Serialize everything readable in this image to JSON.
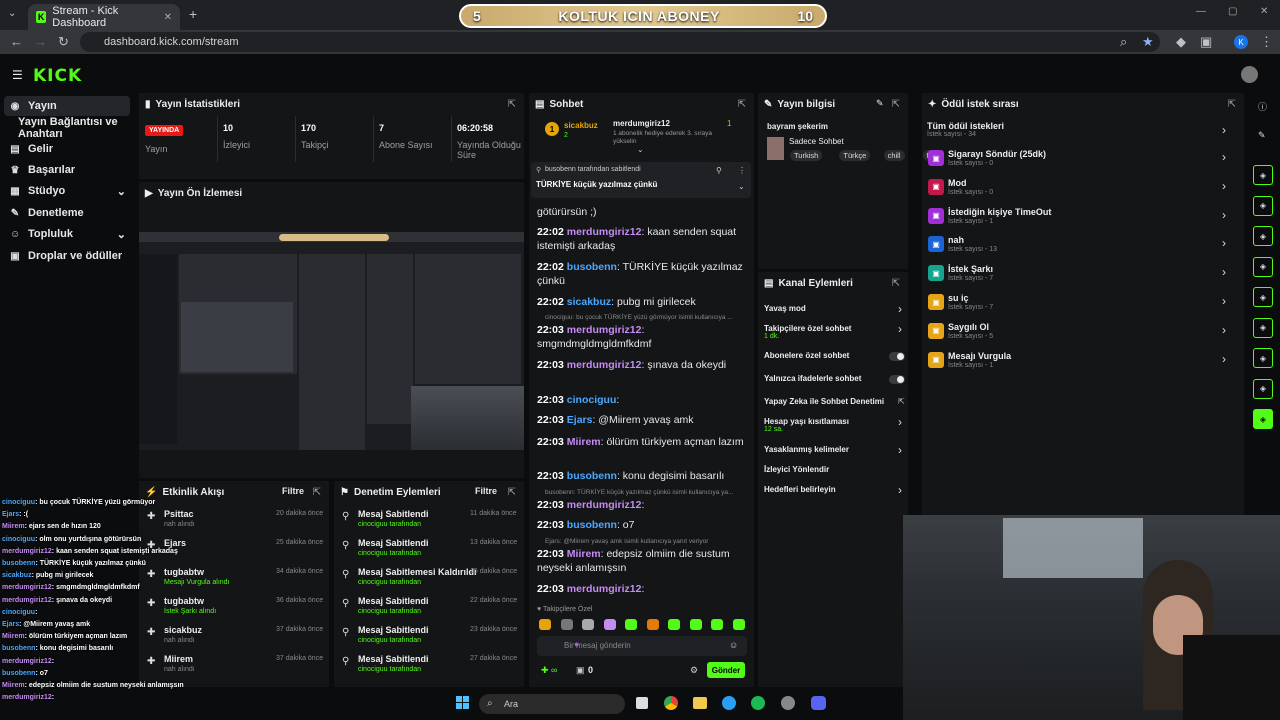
{
  "browser": {
    "tab_title": "Stream - Kick Dashboard",
    "url": "dashboard.kick.com/stream"
  },
  "overlay_banner": {
    "left": "5",
    "title": "KOLTUK ICIN ABONEY",
    "right": "10"
  },
  "logo": "KICK",
  "sidebar": {
    "items": [
      {
        "label": "Yayın",
        "icon": "broadcast-icon"
      },
      {
        "label": "Yayın Bağlantısı ve Anahtarı",
        "icon": ""
      },
      {
        "label": "Gelir",
        "icon": "money-icon"
      },
      {
        "label": "Başarılar",
        "icon": "trophy-icon"
      },
      {
        "label": "Stüdyo",
        "icon": "studio-icon"
      },
      {
        "label": "Denetleme",
        "icon": "wrench-icon"
      },
      {
        "label": "Topluluk",
        "icon": "users-icon"
      },
      {
        "label": "Droplar ve ödüller",
        "icon": "gift-icon"
      }
    ]
  },
  "stats": {
    "title": "Yayın İstatistikleri",
    "live": "YAYINDA",
    "live_label": "Yayın",
    "viewers": "10",
    "viewers_label": "İzleyici",
    "followers": "170",
    "followers_label": "Takipçi",
    "subs": "7",
    "subs_label": "Abone Sayısı",
    "uptime": "06:20:58",
    "uptime_label": "Yayında Olduğu Süre"
  },
  "preview": {
    "title": "Yayın Ön İzlemesi"
  },
  "activity": {
    "title": "Etkinlik Akışı",
    "filter": "Filtre",
    "rows": [
      {
        "name": "Psittac",
        "sub": "nah alındı",
        "time": "20 dakika önce"
      },
      {
        "name": "Ejars",
        "sub": "",
        "time": "25 dakika önce"
      },
      {
        "name": "tugbabtw",
        "sub": "Mesajı Vurgula alındı",
        "time": "34 dakika önce"
      },
      {
        "name": "tugbabtw",
        "sub": "İstek Şarkı alındı",
        "time": "36 dakika önce"
      },
      {
        "name": "sicakbuz",
        "sub": "nah alındı",
        "time": "37 dakika önce"
      },
      {
        "name": "Miirem",
        "sub": "nah alındı",
        "time": "37 dakika önce"
      }
    ]
  },
  "moderation": {
    "title": "Denetim Eylemleri",
    "filter": "Filtre",
    "rows": [
      {
        "name": "Mesaj Sabitlendi",
        "sub": "cinociguu tarafından",
        "time": "11 dakika önce"
      },
      {
        "name": "Mesaj Sabitlendi",
        "sub": "cinociguu tarafından",
        "time": "13 dakika önce"
      },
      {
        "name": "Mesaj Sabitlemesi Kaldırıldı",
        "sub": "cinociguu tarafından",
        "time": "15 dakika önce"
      },
      {
        "name": "Mesaj Sabitlendi",
        "sub": "cinociguu tarafından",
        "time": "22 dakika önce"
      },
      {
        "name": "Mesaj Sabitlendi",
        "sub": "cinociguu tarafından",
        "time": "23 dakika önce"
      },
      {
        "name": "Mesaj Sabitlendi",
        "sub": "cinociguu tarafından",
        "time": "27 dakika önce"
      }
    ]
  },
  "chat": {
    "title": "Sohbet",
    "gift_user": "sicakbuz",
    "gift_count": "2",
    "gift_target": "merdumgiriz12",
    "gift_target_count": "1",
    "gift_text": "1 abonelik hediye ederek 3. sıraya yükselin",
    "pinned_by": "busobenn tarafından sabitlendi",
    "pinned_text": "TÜRKİYE küçük yazılmaz çünkü",
    "messages": [
      {
        "time": "",
        "user": "",
        "text": "götürürsün ;)"
      },
      {
        "time": "22:02",
        "user": "merdumgiriz12",
        "text": ": kaan senden squat istemişti arkadaş"
      },
      {
        "time": "22:02",
        "user": "busobenn",
        "text": ": TÜRKİYE küçük yazılmaz çünkü"
      },
      {
        "time": "22:02",
        "user": "sicakbuz",
        "text": ": pubg mi girilecek"
      },
      {
        "time": "22:03",
        "user": "merdumgiriz12",
        "text": ": smgmdmgldmgldmfkdmf"
      },
      {
        "time": "22:03",
        "user": "merdumgiriz12",
        "text": ": şınava da okeydi"
      },
      {
        "time": "22:03",
        "user": "cinociguu",
        "text": ":"
      },
      {
        "time": "22:03",
        "user": "Ejars",
        "text": ": @Miirem yavaş amk"
      },
      {
        "time": "22:03",
        "user": "Miirem",
        "text": ": ölürüm türkiyem açman lazım"
      },
      {
        "time": "22:03",
        "user": "busobenn",
        "text": ": konu degisimi basarılı"
      },
      {
        "time": "22:03",
        "user": "merdumgiriz12",
        "text": ":"
      },
      {
        "time": "22:03",
        "user": "busobenn",
        "text": ": o7"
      },
      {
        "time": "22:03",
        "user": "Miirem",
        "text": ": edepsiz olmiim die sustum neyseki anlamışsın"
      },
      {
        "time": "22:03",
        "user": "merdumgiriz12",
        "text": ":"
      }
    ],
    "sys1": "cinociguu: bu çocuk TÜRKİYE yüzü görmüyor isimli kullanıcıya ...",
    "sys2": "busobenn: TÜRKİYE küçük yazılmaz çünkü isimli kullanıcıya ya...",
    "sys3": "Ejars: @Miirem yavaş amk isimli kullanıcıya yanıt veriyor",
    "followers_only": "Takipçilere Özel",
    "input_placeholder": "Bir mesaj gönderin",
    "points": "0",
    "send": "Gönder"
  },
  "stream_info": {
    "title": "Yayın bilgisi",
    "stream_title": "bayram şekerim",
    "category": "Sadece Sohbet",
    "tags": [
      "Turkish",
      "Türkçe",
      "chill",
      "fu"
    ]
  },
  "channel_actions": {
    "title": "Kanal Eylemleri",
    "items": [
      {
        "label": "Yavaş mod",
        "sub": "",
        "kind": "chevron"
      },
      {
        "label": "Takipçilere özel sohbet",
        "sub": "1 dk.",
        "kind": "chevron"
      },
      {
        "label": "Abonelere özel sohbet",
        "sub": "",
        "kind": "toggle"
      },
      {
        "label": "Yalnızca ifadelerle sohbet",
        "sub": "",
        "kind": "toggle"
      },
      {
        "label": "Yapay Zeka ile Sohbet Denetimi",
        "sub": "",
        "kind": "external"
      },
      {
        "label": "Hesap yaşı kısıtlaması",
        "sub": "12 sa.",
        "kind": "chevron"
      },
      {
        "label": "Yasaklanmış kelimeler",
        "sub": "",
        "kind": "chevron"
      },
      {
        "label": "İzleyici Yönlendir",
        "sub": "",
        "kind": "none"
      },
      {
        "label": "Hedefleri belirleyin",
        "sub": "",
        "kind": "chevron"
      }
    ]
  },
  "rewards": {
    "title": "Ödül istek sırası",
    "all_label": "Tüm ödül istekleri",
    "all_sub": "İstek sayısı - 34",
    "items": [
      {
        "label": "Sigarayı Söndür (25dk)",
        "sub": "İstek sayısı - 0",
        "color": "#a12fd6"
      },
      {
        "label": "Mod",
        "sub": "İstek sayısı - 0",
        "color": "#c2184b"
      },
      {
        "label": "İstediğin kişiye TimeOut",
        "sub": "İstek sayısı - 1",
        "color": "#a12fd6"
      },
      {
        "label": "nah",
        "sub": "İstek sayısı - 13",
        "color": "#1c64d6"
      },
      {
        "label": "İstek Şarkı",
        "sub": "İstek sayısı - 7",
        "color": "#15a58e"
      },
      {
        "label": "su iç",
        "sub": "İstek sayısı - 7",
        "color": "#e6a519"
      },
      {
        "label": "Saygılı Ol",
        "sub": "İstek sayısı - 5",
        "color": "#e6a519"
      },
      {
        "label": "Mesajı Vurgula",
        "sub": "İstek sayısı - 1",
        "color": "#e6a519"
      }
    ]
  },
  "overlay_chat": [
    {
      "user": "cinociguu",
      "text": ": bu çocuk TÜRKİYE yüzü görmüyor"
    },
    {
      "user": "Ejars",
      "text": ": :("
    },
    {
      "user": "Miirem",
      "text": ": ejars sen de hızın 120"
    },
    {
      "user": "cinociguu",
      "text": ": olm onu yurtdışına götürürsün"
    },
    {
      "user": "merdumgiriz12",
      "text": ": kaan senden squat istemişti arkadaş"
    },
    {
      "user": "busobenn",
      "text": ": TÜRKİYE küçük yazılmaz çünkü"
    },
    {
      "user": "sicakbuz",
      "text": ": pubg mi girilecek"
    },
    {
      "user": "merdumgiriz12",
      "text": ": smgmdmgldmgldmfkdmf"
    },
    {
      "user": "merdumgiriz12",
      "text": ": şınava da okeydi"
    },
    {
      "user": "cinociguu",
      "text": ":"
    },
    {
      "user": "Ejars",
      "text": ": @Miirem yavaş amk"
    },
    {
      "user": "Miirem",
      "text": ": ölürüm türkiyem açman lazım"
    },
    {
      "user": "busobenn",
      "text": ": konu degisimi basarılı"
    },
    {
      "user": "merdumgiriz12",
      "text": ":"
    },
    {
      "user": "busobenn",
      "text": ": o7"
    },
    {
      "user": "Miirem",
      "text": ": edepsiz olmiim die sustum neyseki anlamışsın"
    },
    {
      "user": "merdumgiriz12",
      "text": ":"
    }
  ],
  "taskbar": {
    "search": "Ara"
  },
  "colors": {
    "accent": "#53fc18",
    "live": "#e91916"
  }
}
